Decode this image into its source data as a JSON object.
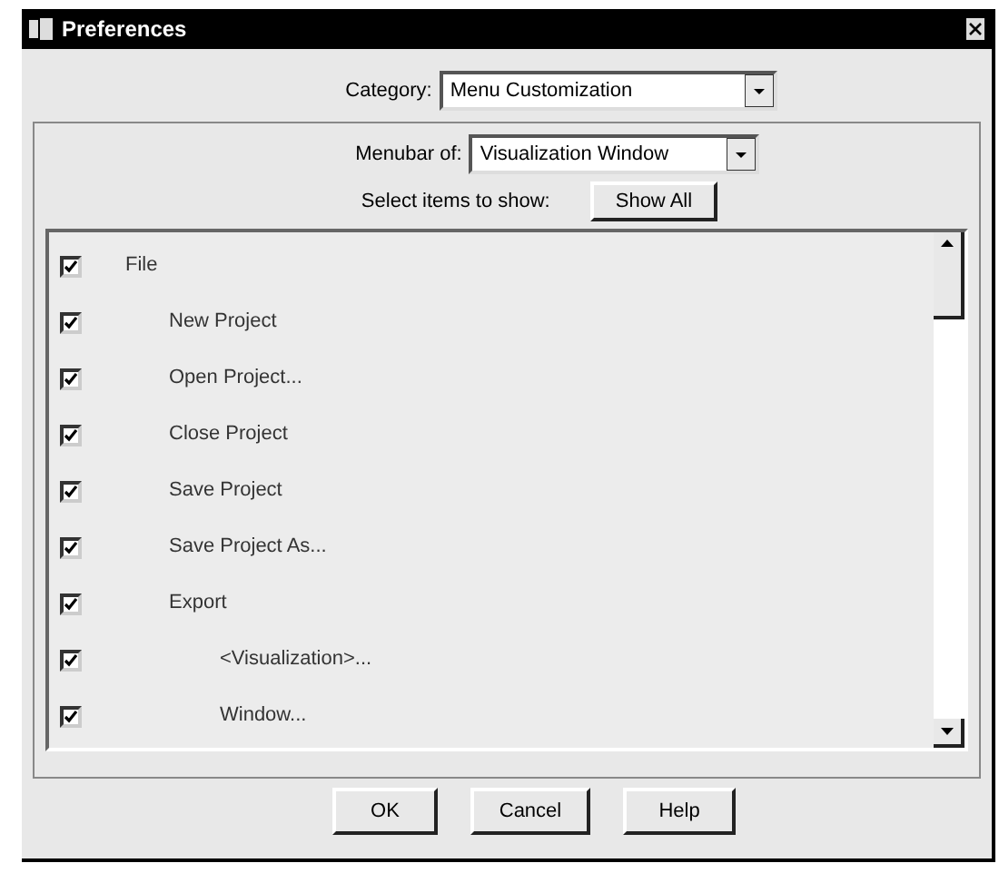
{
  "window": {
    "title": "Preferences"
  },
  "category": {
    "label": "Category:",
    "value": "Menu Customization"
  },
  "menubar": {
    "label": "Menubar of:",
    "value": "Visualization Window"
  },
  "select_label": "Select items to show:",
  "show_all_button": "Show All",
  "items": [
    {
      "label": "File",
      "checked": true,
      "children": [
        {
          "label": "New Project",
          "checked": true
        },
        {
          "label": "Open Project...",
          "checked": true
        },
        {
          "label": "Close Project",
          "checked": true
        },
        {
          "label": "Save Project",
          "checked": true
        },
        {
          "label": "Save Project As...",
          "checked": true
        },
        {
          "label": "Export",
          "checked": true,
          "children": [
            {
              "label": "<Visualization>...",
              "checked": true
            },
            {
              "label": "Window...",
              "checked": true
            }
          ]
        }
      ]
    }
  ],
  "buttons": [
    "OK",
    "Cancel",
    "Help"
  ]
}
